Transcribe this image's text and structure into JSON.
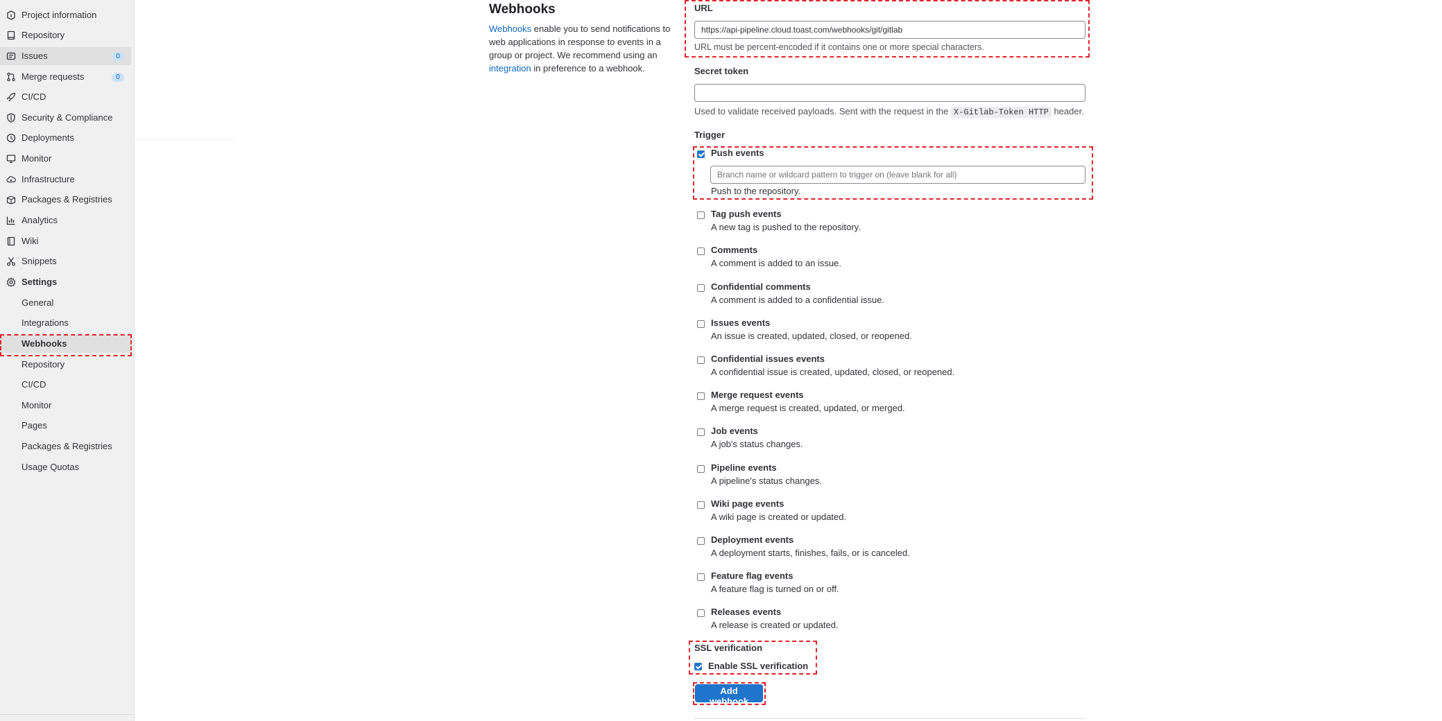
{
  "sidebar": {
    "items": [
      {
        "label": "Project information",
        "icon": "project-icon"
      },
      {
        "label": "Repository",
        "icon": "repository-icon"
      },
      {
        "label": "Issues",
        "icon": "issues-icon",
        "badge": "0"
      },
      {
        "label": "Merge requests",
        "icon": "merge-request-icon",
        "badge": "0"
      },
      {
        "label": "CI/CD",
        "icon": "rocket-icon"
      },
      {
        "label": "Security & Compliance",
        "icon": "shield-icon"
      },
      {
        "label": "Deployments",
        "icon": "deployments-icon"
      },
      {
        "label": "Monitor",
        "icon": "monitor-icon"
      },
      {
        "label": "Infrastructure",
        "icon": "cloud-gear-icon"
      },
      {
        "label": "Packages & Registries",
        "icon": "package-icon"
      },
      {
        "label": "Analytics",
        "icon": "chart-icon"
      },
      {
        "label": "Wiki",
        "icon": "book-icon"
      },
      {
        "label": "Snippets",
        "icon": "snippet-icon"
      },
      {
        "label": "Settings",
        "icon": "gear-icon"
      }
    ],
    "settings_items": [
      {
        "label": "General"
      },
      {
        "label": "Integrations"
      },
      {
        "label": "Webhooks"
      },
      {
        "label": "Repository"
      },
      {
        "label": "CI/CD"
      },
      {
        "label": "Monitor"
      },
      {
        "label": "Pages"
      },
      {
        "label": "Packages & Registries"
      },
      {
        "label": "Usage Quotas"
      }
    ]
  },
  "section": {
    "title": "Webhooks",
    "desc_link1": "Webhooks",
    "desc_text1": " enable you to send notifications to web applications in response to events in a group or project. We recommend using an ",
    "desc_link2": "integration",
    "desc_text2": " in preference to a webhook."
  },
  "form": {
    "url_label": "URL",
    "url_value": "https://api-pipeline.cloud.toast.com/webhooks/git/gitlab",
    "url_help": "URL must be percent-encoded if it contains one or more special characters.",
    "token_label": "Secret token",
    "token_value": "",
    "token_help_prefix": "Used to validate received payloads. Sent with the request in the ",
    "token_help_code": "X-Gitlab-Token HTTP",
    "token_help_suffix": " header.",
    "trigger_label": "Trigger",
    "push_title": "Push events",
    "push_checked": true,
    "push_placeholder": "Branch name or wildcard pattern to trigger on (leave blank for all)",
    "push_desc": "Push to the repository.",
    "triggers": [
      {
        "title": "Tag push events",
        "desc": "A new tag is pushed to the repository.",
        "checked": false
      },
      {
        "title": "Comments",
        "desc": "A comment is added to an issue.",
        "checked": false
      },
      {
        "title": "Confidential comments",
        "desc": "A comment is added to a confidential issue.",
        "checked": false
      },
      {
        "title": "Issues events",
        "desc": "An issue is created, updated, closed, or reopened.",
        "checked": false
      },
      {
        "title": "Confidential issues events",
        "desc": "A confidential issue is created, updated, closed, or reopened.",
        "checked": false
      },
      {
        "title": "Merge request events",
        "desc": "A merge request is created, updated, or merged.",
        "checked": false
      },
      {
        "title": "Job events",
        "desc": "A job's status changes.",
        "checked": false
      },
      {
        "title": "Pipeline events",
        "desc": "A pipeline's status changes.",
        "checked": false
      },
      {
        "title": "Wiki page events",
        "desc": "A wiki page is created or updated.",
        "checked": false
      },
      {
        "title": "Deployment events",
        "desc": "A deployment starts, finishes, fails, or is canceled.",
        "checked": false
      },
      {
        "title": "Feature flag events",
        "desc": "A feature flag is turned on or off.",
        "checked": false
      },
      {
        "title": "Releases events",
        "desc": "A release is created or updated.",
        "checked": false
      }
    ],
    "ssl_label": "SSL verification",
    "ssl_title": "Enable SSL verification",
    "ssl_checked": true,
    "submit_label": "Add webhook"
  },
  "colors": {
    "accent": "#1f75cb",
    "link": "#1068bf",
    "highlight": "#e0242b",
    "sidebar_bg": "#f0f0f0"
  }
}
